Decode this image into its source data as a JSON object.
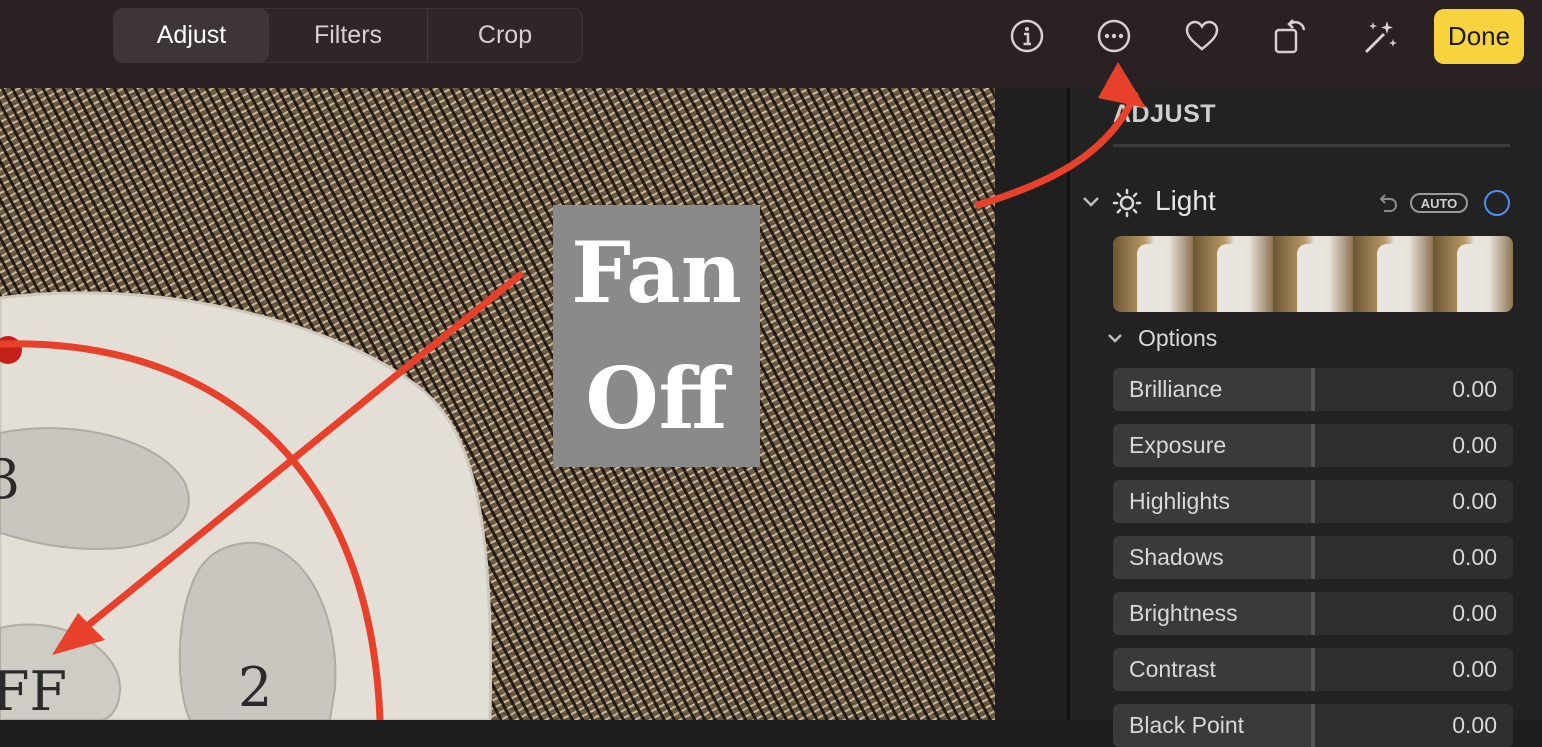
{
  "toolbar": {
    "tabs": [
      {
        "label": "Adjust",
        "selected": true
      },
      {
        "label": "Filters",
        "selected": false
      },
      {
        "label": "Crop",
        "selected": false
      }
    ],
    "icons": [
      "info-icon",
      "more-icon",
      "heart-icon",
      "rotate-icon",
      "auto-enhance-icon"
    ],
    "done_label": "Done",
    "done_color": "#f7d33e"
  },
  "photo": {
    "label_line1": "Fan",
    "label_line2": "Off",
    "remote_button_labels": [
      "3",
      "2",
      "FF"
    ]
  },
  "annotation_color": "#e8412b",
  "sidebar": {
    "title": "ADJUST",
    "section": {
      "label": "Light",
      "auto_label": "AUTO",
      "toggle_color": "#4f8ff0"
    },
    "options_label": "Options",
    "sliders": [
      {
        "name": "Brilliance",
        "value": "0.00"
      },
      {
        "name": "Exposure",
        "value": "0.00"
      },
      {
        "name": "Highlights",
        "value": "0.00"
      },
      {
        "name": "Shadows",
        "value": "0.00"
      },
      {
        "name": "Brightness",
        "value": "0.00"
      },
      {
        "name": "Contrast",
        "value": "0.00"
      },
      {
        "name": "Black Point",
        "value": "0.00"
      }
    ]
  }
}
